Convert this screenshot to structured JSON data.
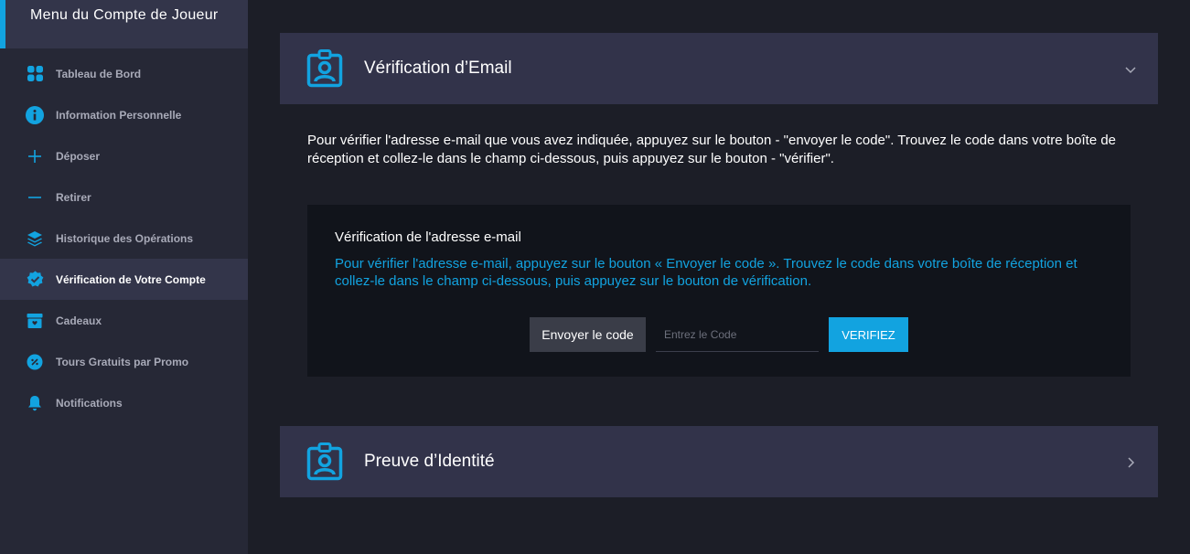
{
  "sidebar": {
    "title": "Menu du Compte de Joueur",
    "items": [
      {
        "label": "Tableau de Bord",
        "icon": "dashboard-icon"
      },
      {
        "label": "Information Personnelle",
        "icon": "info-icon"
      },
      {
        "label": "Déposer",
        "icon": "plus-icon"
      },
      {
        "label": "Retirer",
        "icon": "minus-icon"
      },
      {
        "label": "Historique des Opérations",
        "icon": "layers-icon"
      },
      {
        "label": "Vérification de Votre Compte",
        "icon": "verified-badge-icon",
        "active": true
      },
      {
        "label": "Cadeaux",
        "icon": "gift-box-icon"
      },
      {
        "label": "Tours Gratuits par Promo",
        "icon": "promo-icon"
      },
      {
        "label": "Notifications",
        "icon": "bell-icon"
      }
    ]
  },
  "email_section": {
    "title": "Vérification d’Email",
    "icon": "id-badge-icon",
    "expanded": true,
    "intro": "Pour vérifier l'adresse e-mail que vous avez indiquée, appuyez sur le bouton - \"envoyer le code\". Trouvez le code dans votre boîte de réception et collez-le dans le champ ci-dessous, puis appuyez sur le bouton - \"vérifier\".",
    "box": {
      "title": "Vérification de l'adresse e-mail",
      "description": "Pour vérifier l'adresse e-mail, appuyez sur le bouton « Envoyer le code ». Trouvez le code dans votre boîte de réception et collez-le dans le champ ci-dessous, puis appuyez sur le bouton de vérification.",
      "send_label": "Envoyer le code",
      "code_placeholder": "Entrez le Code",
      "code_value": "",
      "verify_label": "VERIFIEZ"
    }
  },
  "identity_section": {
    "title": "Preuve d’Identité",
    "icon": "id-badge-icon",
    "expanded": false
  },
  "colors": {
    "accent": "#12a3e0",
    "background": "#1c1e27",
    "sidebar": "#262836",
    "panel": "#32334a",
    "box": "#11141b"
  }
}
